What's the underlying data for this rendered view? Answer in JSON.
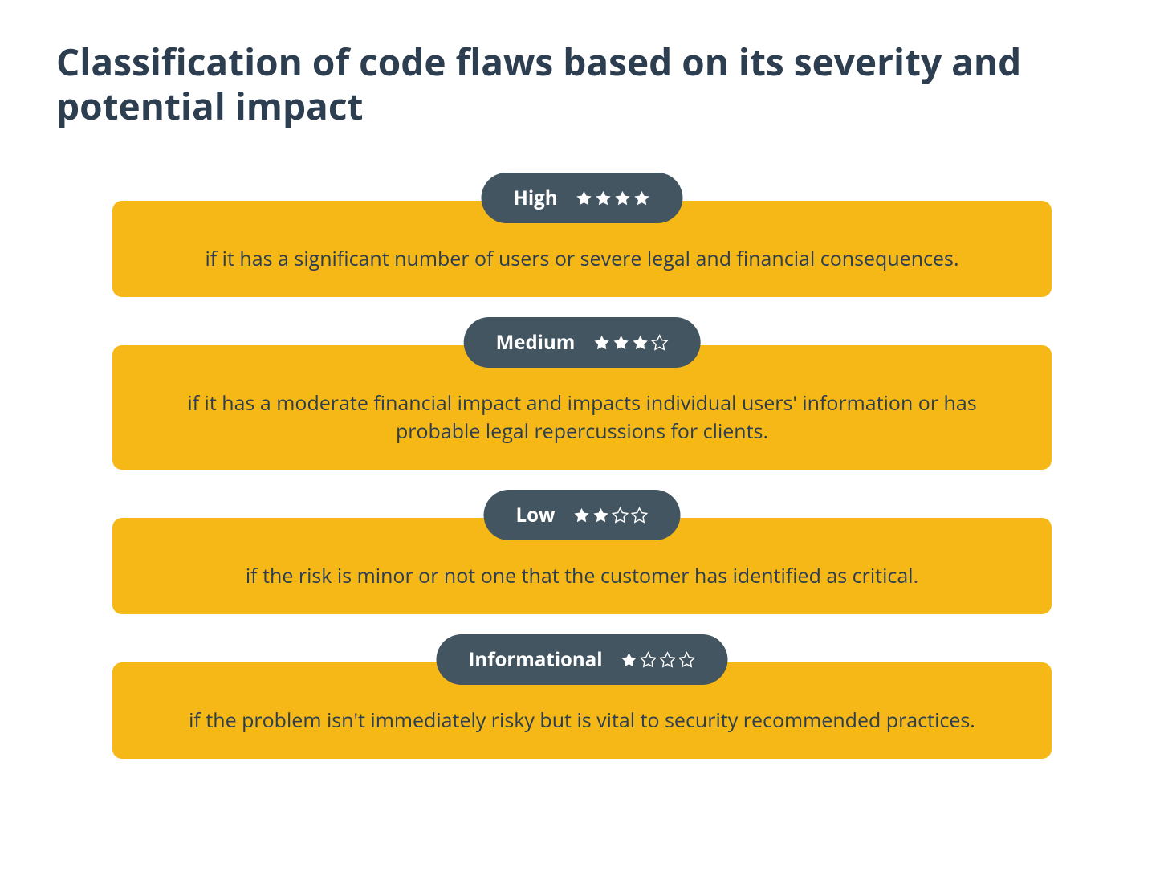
{
  "title": "Classification of code flaws based on its severity and potential impact",
  "colors": {
    "pill_bg": "#435560",
    "box_bg": "#f5b816",
    "title_text": "#2c3e50",
    "description_text": "#2c3e50",
    "star_color": "#ffffff"
  },
  "items": [
    {
      "label": "High",
      "stars_filled": 4,
      "stars_total": 4,
      "description": "if it has a significant number of users or severe legal and financial consequences."
    },
    {
      "label": "Medium",
      "stars_filled": 3,
      "stars_total": 4,
      "description": "if it has a moderate financial impact and impacts individual users' information or has probable legal repercussions for clients."
    },
    {
      "label": "Low",
      "stars_filled": 2,
      "stars_total": 4,
      "description": "if the risk is minor or not one that the customer has identified as critical."
    },
    {
      "label": "Informational",
      "stars_filled": 1,
      "stars_total": 4,
      "description": "if the problem isn't immediately risky but is vital to security recommended practices."
    }
  ]
}
